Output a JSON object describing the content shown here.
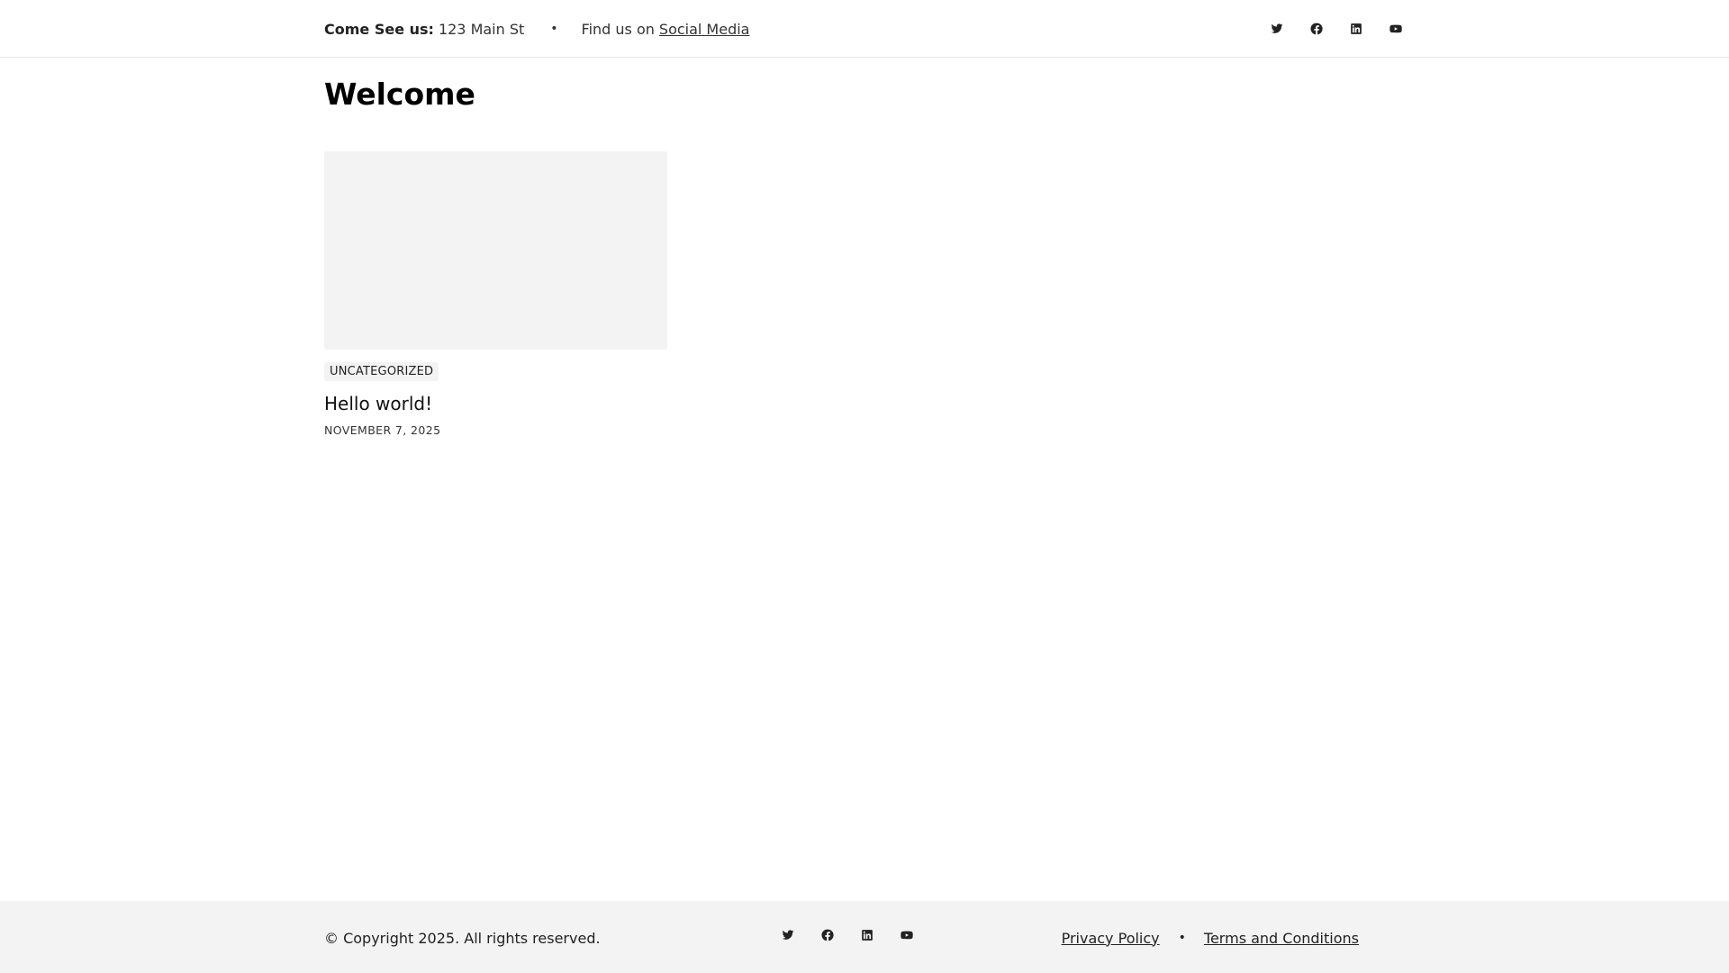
{
  "topbar": {
    "address_label": "Come See us:",
    "address_value": "123 Main St",
    "separator": "•",
    "find_text": "Find us on",
    "social_link": "Social Media",
    "social_icons": [
      "twitter-icon",
      "facebook-icon",
      "linkedin-icon",
      "youtube-icon"
    ]
  },
  "main": {
    "title": "Welcome",
    "posts": [
      {
        "category": "UNCATEGORIZED",
        "title": "Hello world!",
        "date": "NOVEMBER 7, 2025"
      }
    ]
  },
  "footer": {
    "copyright": "© Copyright 2025. All rights reserved.",
    "social_icons": [
      "twitter-icon",
      "facebook-icon",
      "linkedin-icon",
      "youtube-icon"
    ],
    "links": [
      "Privacy Policy",
      "Terms and Conditions"
    ],
    "separator": "•"
  },
  "colors": {
    "text": "#222222",
    "background": "#ffffff",
    "footer_bg": "#f3f3f3",
    "thumbnail_bg": "#f3f3f3",
    "border": "#e8e8e8"
  }
}
